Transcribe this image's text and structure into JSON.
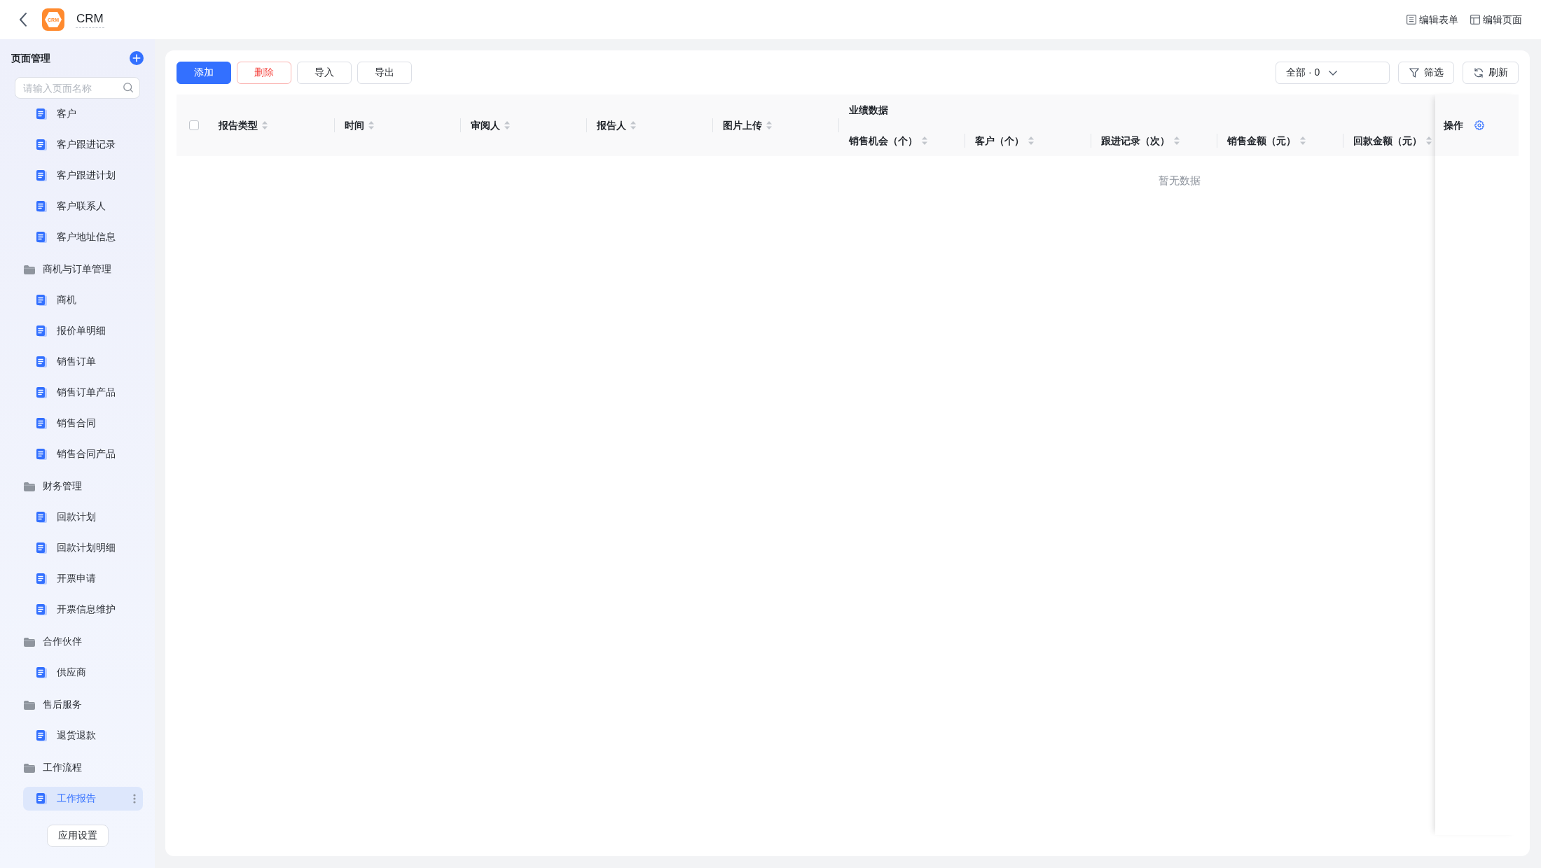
{
  "top_bar": {
    "logo_text": "CRM",
    "app_name": "CRM",
    "actions": [
      {
        "label": "编辑表单",
        "kind": "form"
      },
      {
        "label": "编辑页面",
        "kind": "page"
      }
    ]
  },
  "sidebar": {
    "title": "页面管理",
    "search": {
      "placeholder": "请输入页面名称"
    },
    "tree": [
      {
        "children": [
          {
            "label": "客户",
            "selected": false
          },
          {
            "label": "客户跟进记录",
            "selected": false
          },
          {
            "label": "客户跟进计划",
            "selected": false
          },
          {
            "label": "客户联系人",
            "selected": false
          },
          {
            "label": "客户地址信息",
            "selected": false
          }
        ]
      },
      {
        "label": "商机与订单管理",
        "children": [
          {
            "label": "商机",
            "selected": false
          },
          {
            "label": "报价单明细",
            "selected": false
          },
          {
            "label": "销售订单",
            "selected": false
          },
          {
            "label": "销售订单产品",
            "selected": false
          },
          {
            "label": "销售合同",
            "selected": false
          },
          {
            "label": "销售合同产品",
            "selected": false
          }
        ]
      },
      {
        "label": "财务管理",
        "children": [
          {
            "label": "回款计划",
            "selected": false
          },
          {
            "label": "回款计划明细",
            "selected": false
          },
          {
            "label": "开票申请",
            "selected": false
          },
          {
            "label": "开票信息维护",
            "selected": false
          }
        ]
      },
      {
        "label": "合作伙伴",
        "children": [
          {
            "label": "供应商",
            "selected": false
          }
        ]
      },
      {
        "label": "售后服务",
        "children": [
          {
            "label": "退货退款",
            "selected": false
          }
        ]
      },
      {
        "label": "工作流程",
        "children": [
          {
            "label": "工作报告",
            "selected": true
          }
        ]
      }
    ],
    "footer_button": "应用设置"
  },
  "toolbar": {
    "buttons": [
      {
        "label": "添加",
        "kind": "primary"
      },
      {
        "label": "删除",
        "kind": "danger"
      },
      {
        "label": "导入",
        "kind": "default"
      },
      {
        "label": "导出",
        "kind": "default"
      }
    ],
    "view_select": {
      "value": "全部 · 0"
    },
    "actions": [
      {
        "label": "筛选",
        "kind": "filter"
      },
      {
        "label": "刷新",
        "kind": "refresh"
      }
    ]
  },
  "table": {
    "select_all": {
      "checked": false
    },
    "columns": [
      {
        "label": "报告类型"
      },
      {
        "label": "时间"
      },
      {
        "label": "审阅人"
      },
      {
        "label": "报告人"
      },
      {
        "label": "图片上传"
      },
      {
        "label": "业绩数据",
        "children": [
          {
            "label": "销售机会（个）"
          },
          {
            "label": "客户（个）"
          },
          {
            "label": "跟进记录（次）"
          },
          {
            "label": "销售金额（元）"
          },
          {
            "label": "回款金额（元）"
          }
        ]
      }
    ],
    "action_column": {
      "label": "操作"
    },
    "empty_text": "暂无数据"
  }
}
